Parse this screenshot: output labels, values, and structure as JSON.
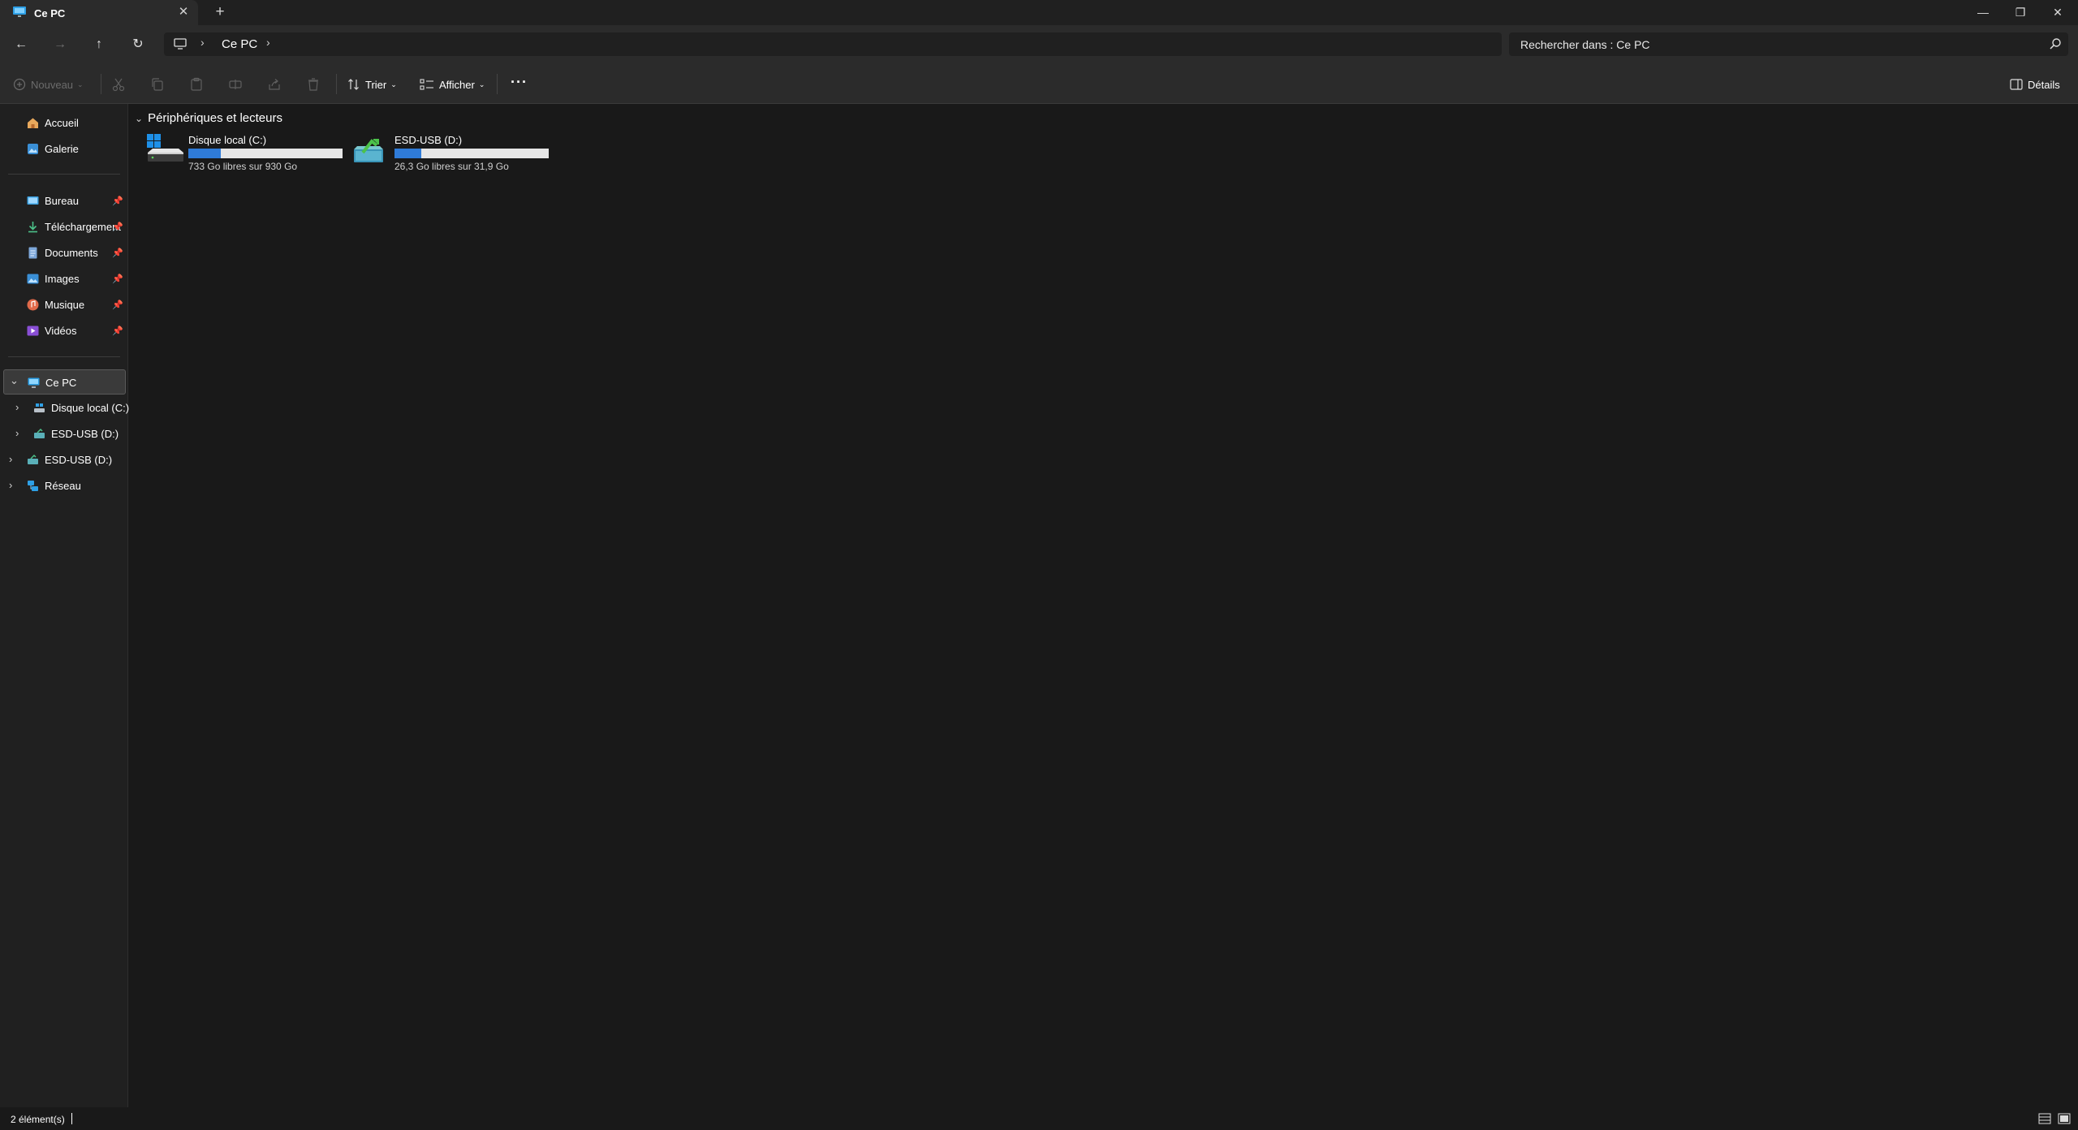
{
  "window": {
    "tab_title": "Ce PC",
    "tab_close": "✕",
    "new_tab": "+",
    "minimize": "—",
    "restore": "❐",
    "close": "✕"
  },
  "nav": {
    "back_icon": "←",
    "forward_icon": "→",
    "up_icon": "↑",
    "refresh_icon": "↻"
  },
  "address": {
    "sep": "›",
    "crumb": "Ce PC",
    "trailing_sep": "›"
  },
  "search": {
    "text": "Rechercher dans : Ce PC"
  },
  "commands": {
    "new_label": "Nouveau",
    "sort_label": "Trier",
    "view_label": "Afficher",
    "more_label": "···",
    "details_label": "Détails",
    "caret": "⌄"
  },
  "sidebar": {
    "quick": [
      {
        "label": "Accueil",
        "icon": "home-icon"
      },
      {
        "label": "Galerie",
        "icon": "gallery-icon"
      }
    ],
    "pinned": [
      {
        "label": "Bureau",
        "icon": "desktop-icon"
      },
      {
        "label": "Téléchargement",
        "icon": "download-icon"
      },
      {
        "label": "Documents",
        "icon": "documents-icon"
      },
      {
        "label": "Images",
        "icon": "pictures-icon"
      },
      {
        "label": "Musique",
        "icon": "music-icon"
      },
      {
        "label": "Vidéos",
        "icon": "videos-icon"
      }
    ],
    "pin_glyph": "📌",
    "tree": {
      "this_pc": "Ce PC",
      "drive_c": "Disque local (C:)",
      "usb_child": "ESD-USB (D:)",
      "usb_root": "ESD-USB (D:)",
      "network": "Réseau",
      "chev_open": "⌄",
      "chev_closed": "›"
    }
  },
  "content": {
    "group_label": "Périphériques et lecteurs",
    "group_chev": "⌄",
    "drives": [
      {
        "name": "Disque local (C:)",
        "free": "733 Go libres sur 930 Go",
        "used_fraction": 0.212
      },
      {
        "name": "ESD-USB (D:)",
        "free": "26,3 Go libres sur 31,9 Go",
        "used_fraction": 0.176
      }
    ]
  },
  "status": {
    "count": "2 élément(s)"
  },
  "colors": {
    "accent": "#2f7bd8",
    "bg": "#191919",
    "panel": "#2b2b2b"
  }
}
